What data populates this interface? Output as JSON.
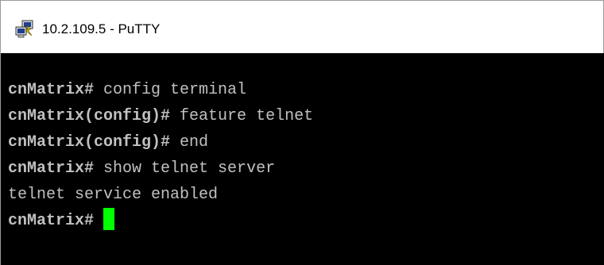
{
  "window": {
    "title": "10.2.109.5 - PuTTY",
    "icon": "putty-icon"
  },
  "terminal": {
    "colors": {
      "background": "#000000",
      "text": "#c0c0c0",
      "cursor": "#00ff00"
    },
    "lines": [
      {
        "prompt": "cnMatrix#",
        "command": " config terminal"
      },
      {
        "prompt": "cnMatrix(config)#",
        "command": " feature telnet"
      },
      {
        "prompt": "cnMatrix(config)#",
        "command": " end"
      },
      {
        "prompt": "cnMatrix#",
        "command": " show telnet server"
      },
      {
        "prompt": "",
        "command": "telnet service enabled"
      },
      {
        "prompt": "cnMatrix#",
        "command": ""
      }
    ]
  }
}
